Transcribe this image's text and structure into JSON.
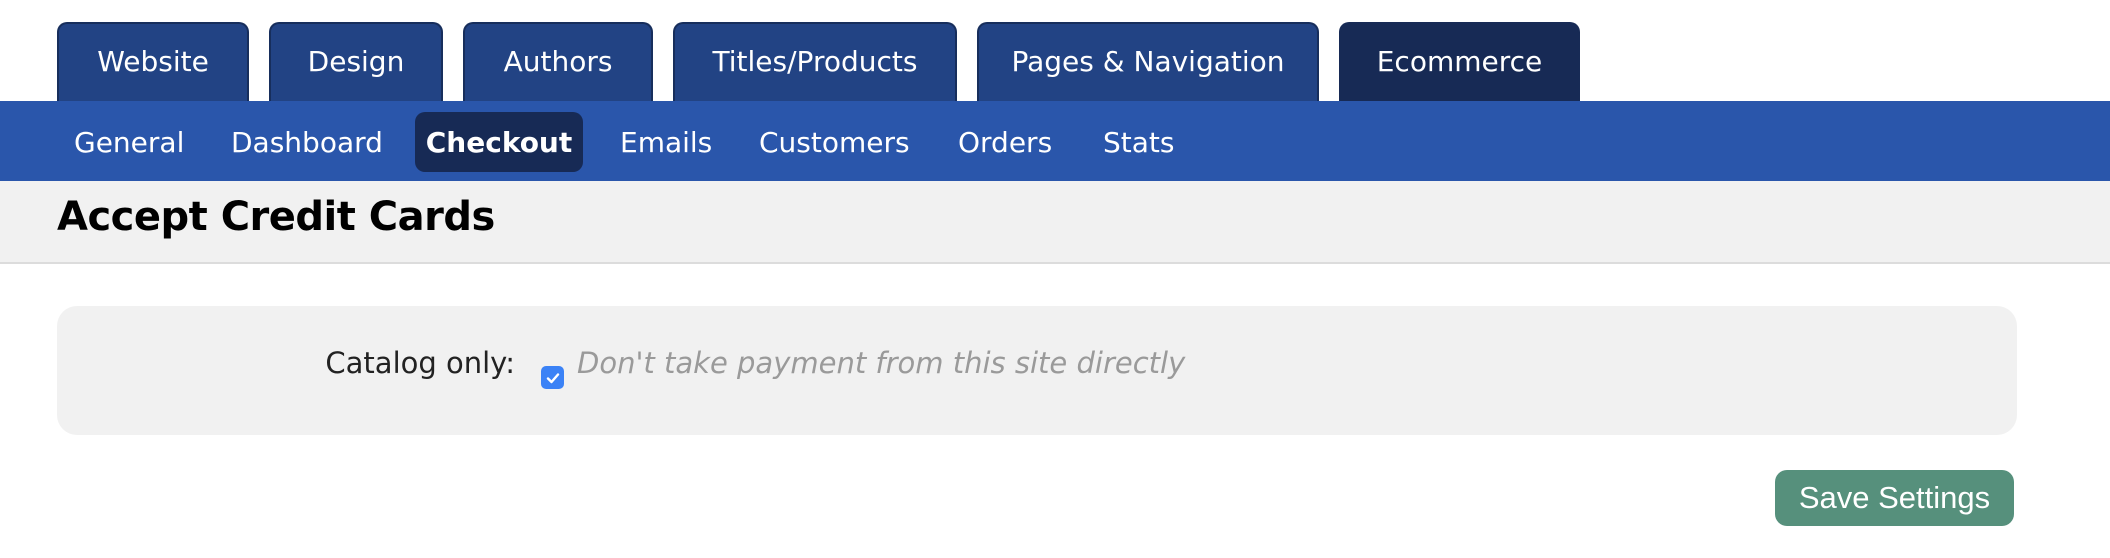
{
  "top_tabs": [
    {
      "label": "Website",
      "active": false
    },
    {
      "label": "Design",
      "active": false
    },
    {
      "label": "Authors",
      "active": false
    },
    {
      "label": "Titles/Products",
      "active": false
    },
    {
      "label": "Pages & Navigation",
      "active": false
    },
    {
      "label": "Ecommerce",
      "active": true
    }
  ],
  "subnav": [
    {
      "label": "General",
      "active": false
    },
    {
      "label": "Dashboard",
      "active": false
    },
    {
      "label": "Checkout",
      "active": true
    },
    {
      "label": "Emails",
      "active": false
    },
    {
      "label": "Customers",
      "active": false
    },
    {
      "label": "Orders",
      "active": false
    },
    {
      "label": "Stats",
      "active": false
    }
  ],
  "page": {
    "title": "Accept Credit Cards"
  },
  "form": {
    "catalog_only": {
      "label": "Catalog only:",
      "checked": true,
      "hint": "Don't take payment from this site directly"
    }
  },
  "actions": {
    "save_label": "Save Settings"
  },
  "colors": {
    "tab_bg": "#224384",
    "tab_active_bg": "#172a55",
    "subnav_bg": "#2a56ab",
    "checkbox": "#3b82f6",
    "save_button": "#56907c"
  }
}
